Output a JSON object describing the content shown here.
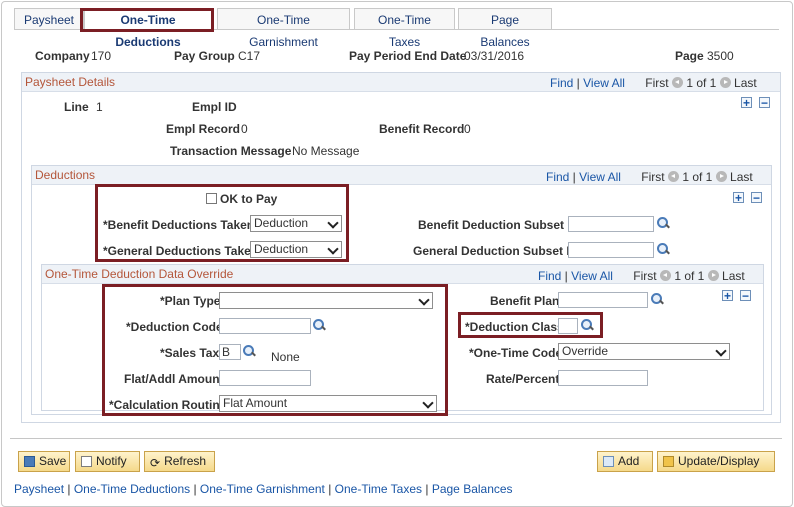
{
  "tabs": [
    {
      "label": "Paysheet"
    },
    {
      "label": "One-Time Deductions"
    },
    {
      "label": "One-Time Garnishment"
    },
    {
      "label": "One-Time Taxes"
    },
    {
      "label": "Page Balances"
    }
  ],
  "header": {
    "company_label": "Company",
    "company_value": "170",
    "pay_group_label": "Pay Group",
    "pay_group_value": "C17",
    "period_end_label": "Pay Period End Date",
    "period_end_value": "03/31/2016",
    "page_label": "Page",
    "page_value": "3500"
  },
  "paysheet_details": {
    "title": "Paysheet Details",
    "find": "Find",
    "view_all": "View All",
    "first": "First",
    "count": "1 of 1",
    "last": "Last",
    "line_label": "Line",
    "line_value": "1",
    "empl_id_label": "Empl ID",
    "empl_record_label": "Empl Record",
    "empl_record_value": "0",
    "benefit_record_label": "Benefit Record",
    "benefit_record_value": "0",
    "txn_msg_label": "Transaction Message",
    "txn_msg_value": "No Message"
  },
  "deductions": {
    "title": "Deductions",
    "find": "Find",
    "view_all": "View All",
    "first": "First",
    "count": "1 of 1",
    "last": "Last",
    "ok_to_pay_label": "OK to Pay",
    "benefit_taken_label": "*Benefit Deductions Taken",
    "benefit_taken_value": "Deduction",
    "general_taken_label": "*General Deductions Taken",
    "general_taken_value": "Deduction",
    "benefit_subset_label": "Benefit Deduction Subset ID",
    "benefit_subset_value": "",
    "general_subset_label": "General Deduction Subset ID",
    "general_subset_value": ""
  },
  "override": {
    "title": "One-Time Deduction Data Override",
    "find": "Find",
    "view_all": "View All",
    "first": "First",
    "count": "1 of 1",
    "last": "Last",
    "plan_type_label": "*Plan Type",
    "plan_type_value": "",
    "deduction_code_label": "*Deduction Code",
    "deduction_code_value": "",
    "sales_tax_label": "*Sales Tax",
    "sales_tax_value": "B",
    "sales_tax_desc": "None",
    "flat_amount_label": "Flat/Addl Amount",
    "flat_amount_value": "",
    "calc_routine_label": "*Calculation Routine",
    "calc_routine_value": "Flat Amount",
    "benefit_plan_label": "Benefit Plan",
    "benefit_plan_value": "",
    "deduction_class_label": "*Deduction Class",
    "deduction_class_value": "",
    "one_time_code_label": "*One-Time Code",
    "one_time_code_value": "Override",
    "rate_percent_label": "Rate/Percent",
    "rate_percent_value": ""
  },
  "toolbar": {
    "save": "Save",
    "notify": "Notify",
    "refresh": "Refresh",
    "add": "Add",
    "update_display": "Update/Display"
  },
  "footer_links": [
    "Paysheet",
    "One-Time Deductions",
    "One-Time Garnishment",
    "One-Time Taxes",
    "Page Balances"
  ],
  "colors": {
    "highlight": "#7b1e24",
    "section_title": "#b4563a",
    "link": "#1a56a6"
  }
}
